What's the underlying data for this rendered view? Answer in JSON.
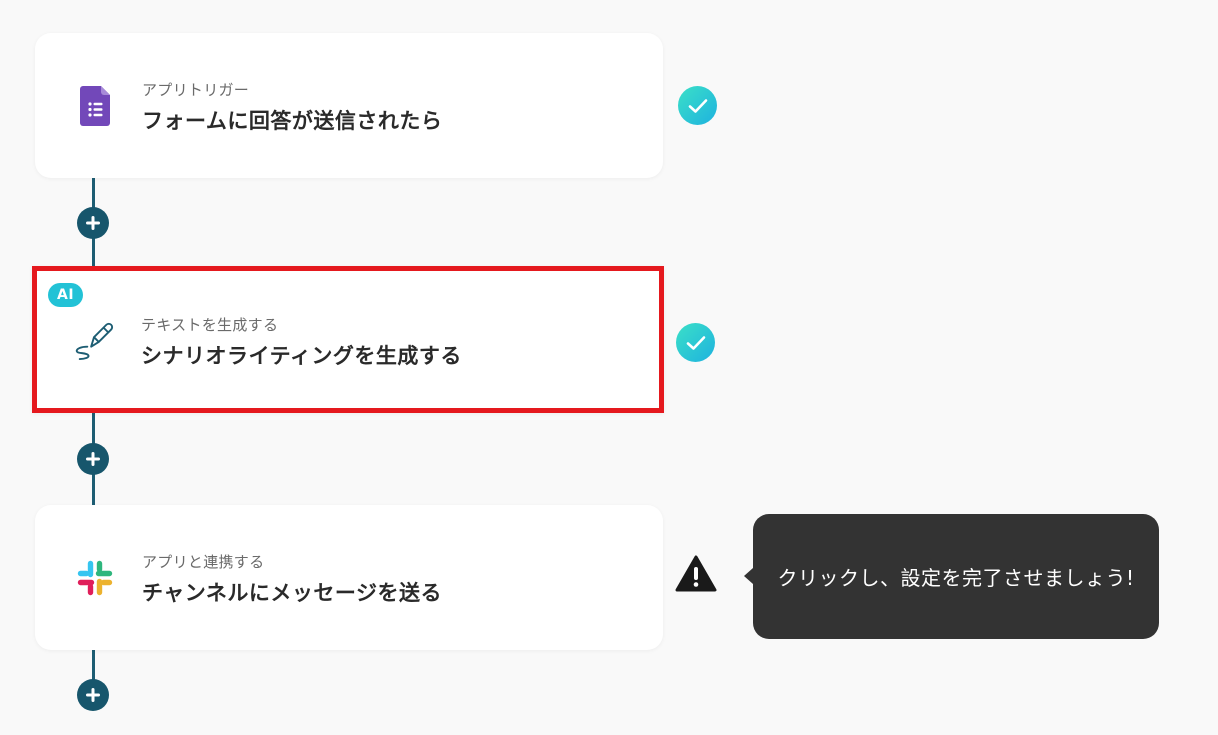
{
  "flow": {
    "steps": [
      {
        "subtitle": "アプリトリガー",
        "title": "フォームに回答が送信されたら",
        "icon": "google-forms-icon",
        "status": "complete"
      },
      {
        "badge": "AI",
        "subtitle": "テキストを生成する",
        "title": "シナリオライティングを生成する",
        "icon": "pen-icon",
        "status": "complete",
        "highlighted": true
      },
      {
        "subtitle": "アプリと連携する",
        "title": "チャンネルにメッセージを送る",
        "icon": "slack-icon",
        "status": "warning"
      }
    ]
  },
  "tooltip": {
    "text": "クリックし、設定を完了させましょう!"
  },
  "colors": {
    "connector": "#1d5d73",
    "add_button": "#17566c",
    "check_start": "#3be0c7",
    "check_end": "#1eb2df",
    "highlight_border": "#e5191e",
    "ai_badge": "#22c2d6",
    "tooltip_bg": "#333333"
  }
}
